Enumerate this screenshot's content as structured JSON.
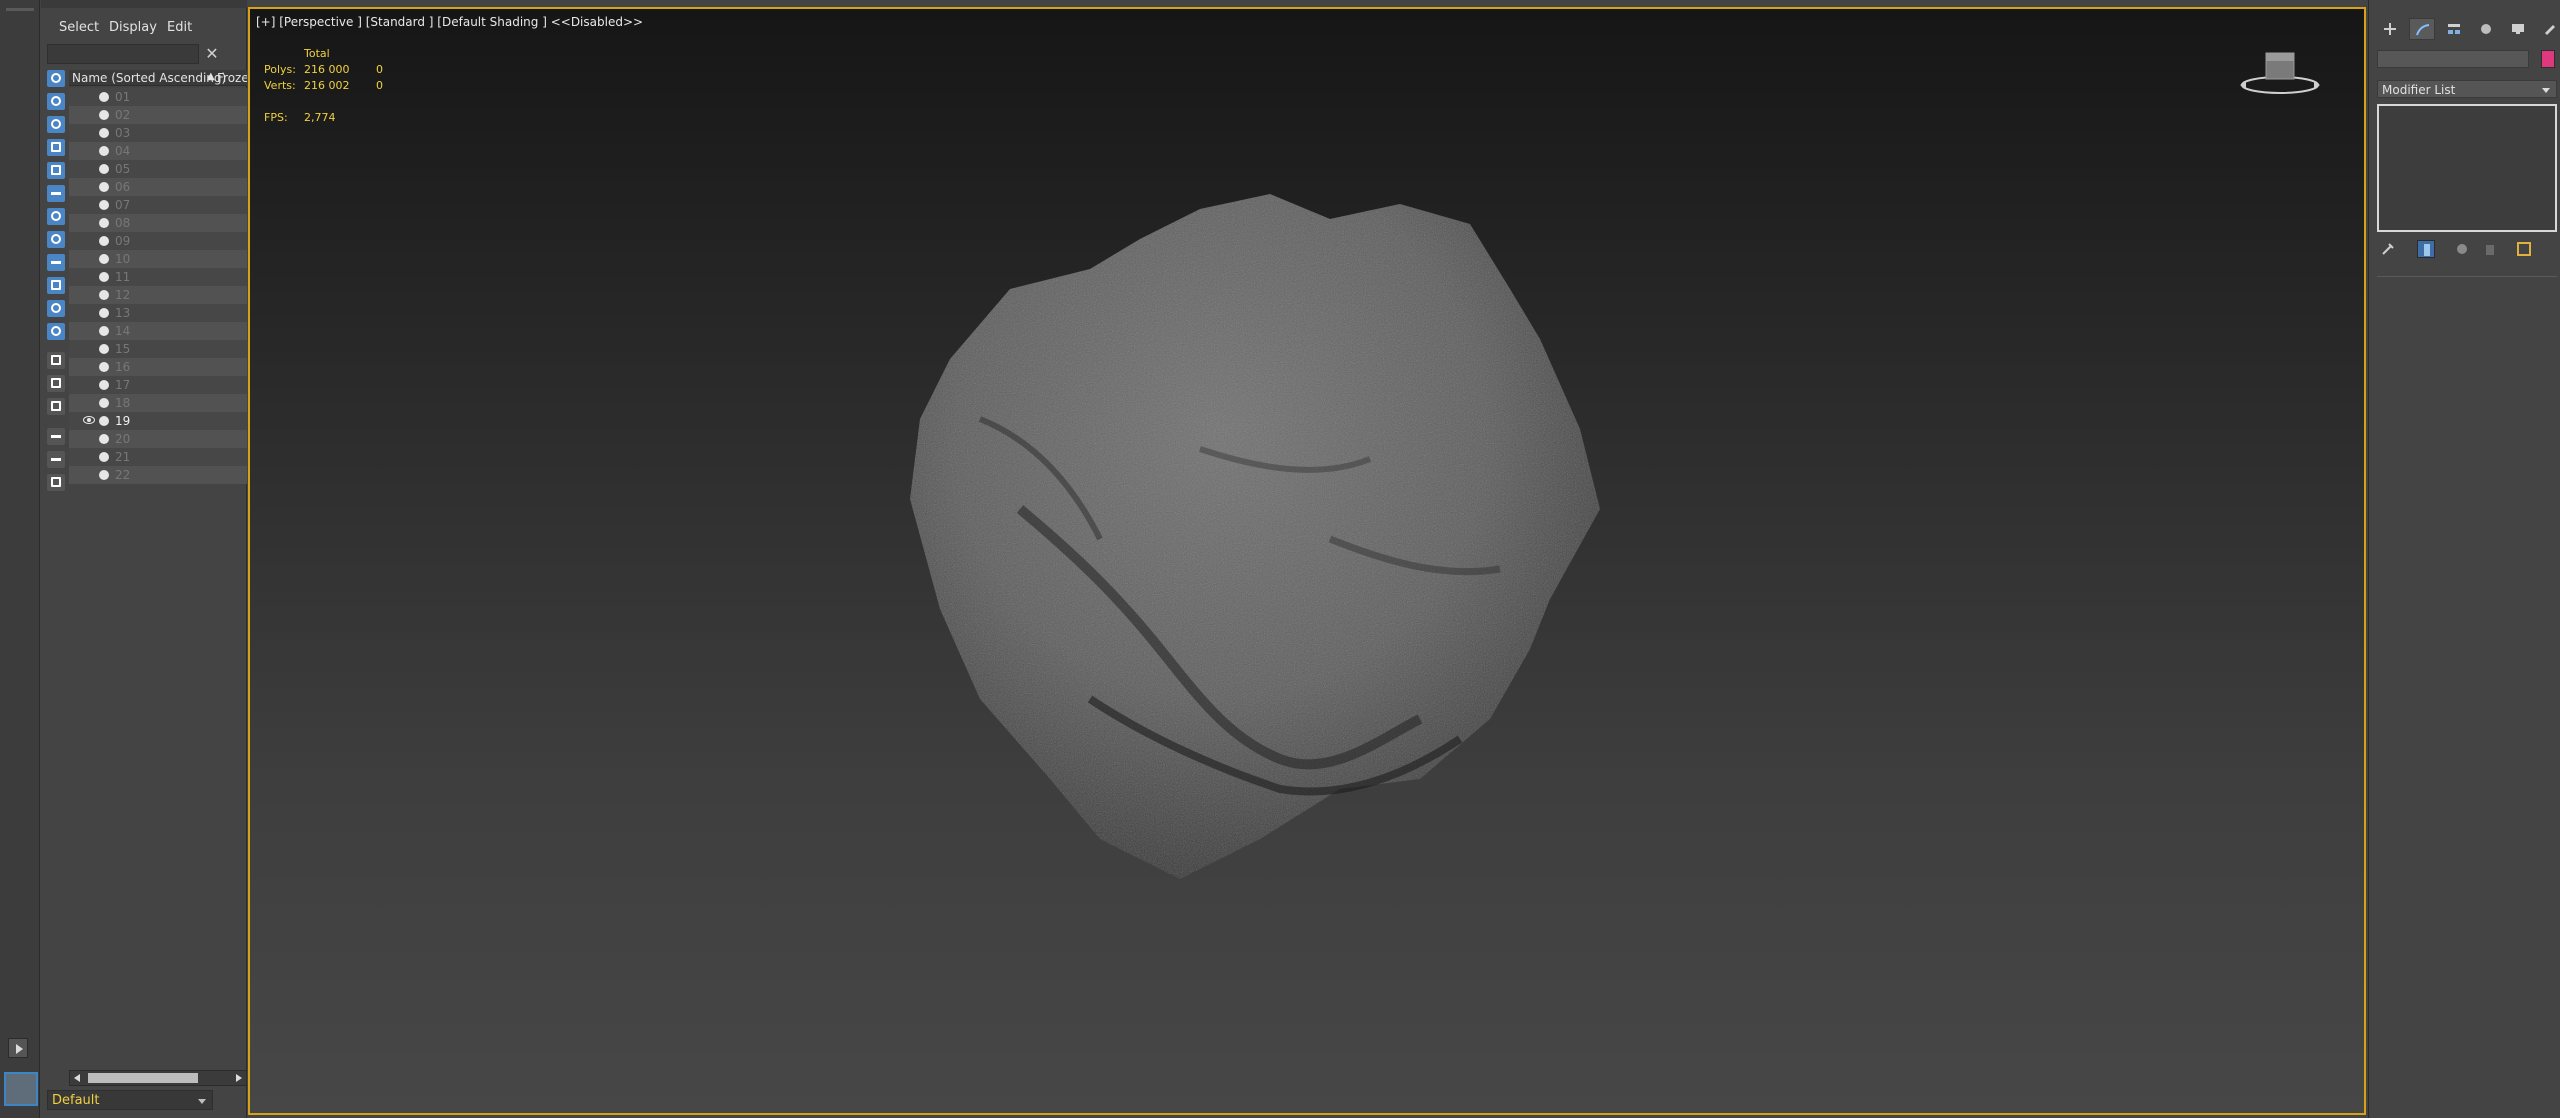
{
  "explorer": {
    "menu": [
      "Select",
      "Display",
      "Edit"
    ],
    "search_placeholder": "",
    "columns": {
      "name": "Name (Sorted Ascending)",
      "sort_indicator": "▲",
      "frozen": "Froze"
    },
    "rows": [
      {
        "label": "01",
        "visible": false
      },
      {
        "label": "02",
        "visible": false
      },
      {
        "label": "03",
        "visible": false
      },
      {
        "label": "04",
        "visible": false
      },
      {
        "label": "05",
        "visible": false
      },
      {
        "label": "06",
        "visible": false
      },
      {
        "label": "07",
        "visible": false
      },
      {
        "label": "08",
        "visible": false
      },
      {
        "label": "09",
        "visible": false
      },
      {
        "label": "10",
        "visible": false
      },
      {
        "label": "11",
        "visible": false
      },
      {
        "label": "12",
        "visible": false
      },
      {
        "label": "13",
        "visible": false
      },
      {
        "label": "14",
        "visible": false
      },
      {
        "label": "15",
        "visible": false
      },
      {
        "label": "16",
        "visible": false
      },
      {
        "label": "17",
        "visible": false
      },
      {
        "label": "18",
        "visible": false
      },
      {
        "label": "19",
        "visible": true
      },
      {
        "label": "20",
        "visible": false
      },
      {
        "label": "21",
        "visible": false
      },
      {
        "label": "22",
        "visible": false
      }
    ],
    "layer": "Default"
  },
  "viewport": {
    "label": "[+] [Perspective ] [Standard ] [Default Shading ]  <<Disabled>>",
    "stats": {
      "total_header": "Total",
      "polys_label": "Polys:",
      "polys_total": "216 000",
      "polys_selected": "0",
      "verts_label": "Verts:",
      "verts_total": "216 002",
      "verts_selected": "0",
      "fps_label": "FPS:",
      "fps_value": "2,774"
    }
  },
  "command_panel": {
    "modifier_list": "Modifier List",
    "object_color": "#e0387f"
  },
  "colors": {
    "viewport_border": "#d6a317",
    "stats_text": "#f0d040",
    "accent_blue": "#4a86c5"
  }
}
